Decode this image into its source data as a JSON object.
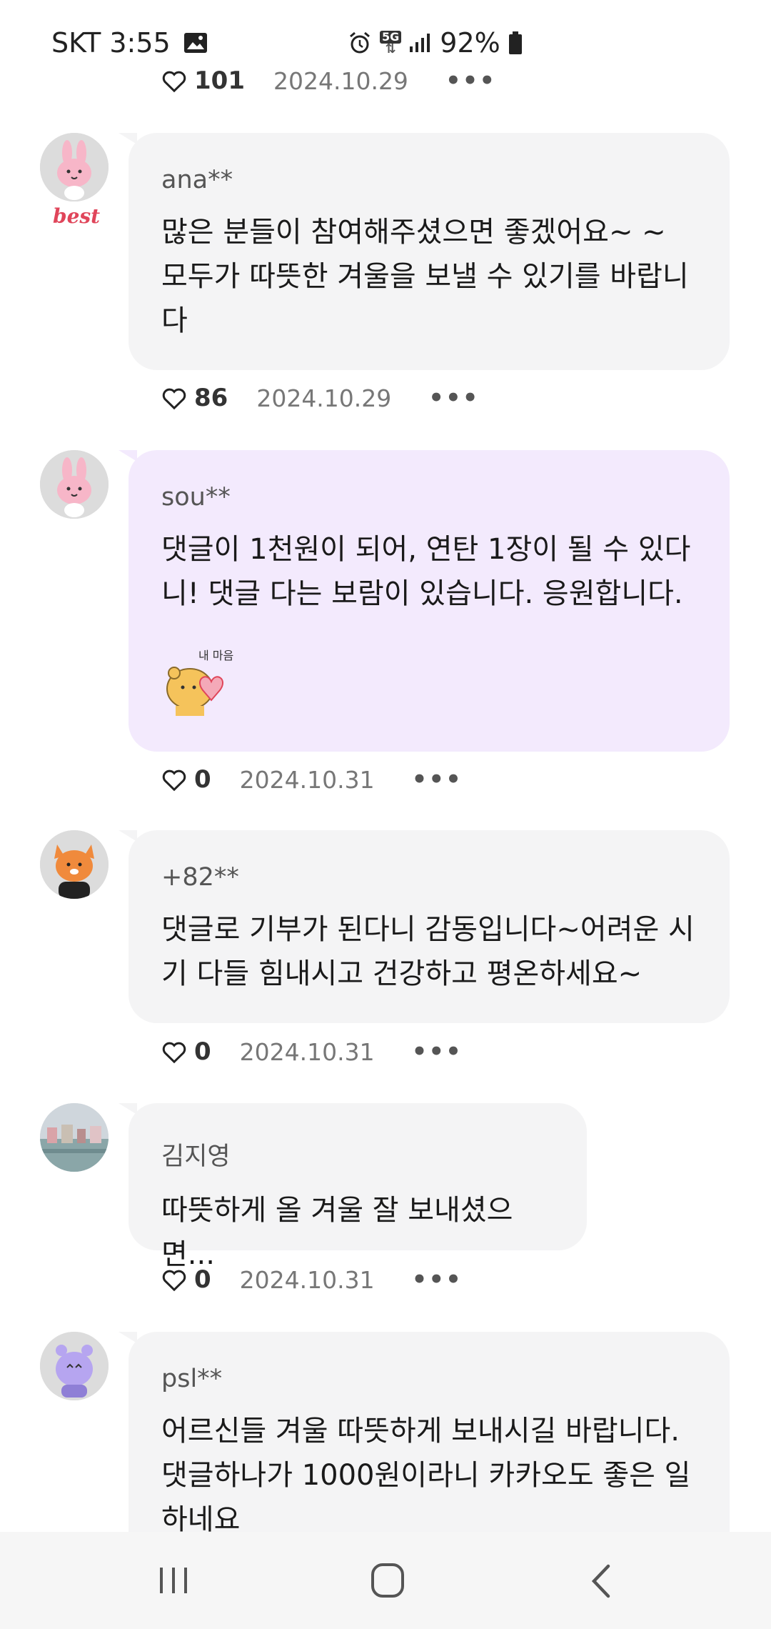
{
  "status_bar": {
    "carrier_time": "SKT 3:55",
    "network": "5G",
    "battery": "92%",
    "icons": [
      "gallery-icon",
      "alarm-icon",
      "5g-icon",
      "signal-icon",
      "battery-icon"
    ]
  },
  "top_partial": {
    "likes": "101",
    "date": "2024.10.29",
    "more": "•••"
  },
  "comments": [
    {
      "author": "ana**",
      "badge": "best",
      "text": "많은 분들이 참여해주셨으면 좋겠어요~ ~ 모두가 따뜻한 겨울을 보낼 수 있기를 바랍니다",
      "likes": "86",
      "date": "2024.10.29",
      "more": "•••",
      "avatar": "pink-rabbit-avatar"
    },
    {
      "author": "sou**",
      "text": "댓글이 1천원이 되어, 연탄 1장이 될 수 있다니! 댓글 다는 보람이 있습니다. 응원합니다.",
      "sticker_text": "내 마음",
      "likes": "0",
      "date": "2024.10.31",
      "more": "•••",
      "avatar": "pink-rabbit-avatar"
    },
    {
      "author": "+82**",
      "text": "댓글로 기부가 된다니  감동입니다~어려운 시기  다들 힘내시고  건강하고 평온하세요~",
      "likes": "0",
      "date": "2024.10.31",
      "more": "•••",
      "avatar": "raccoon-avatar"
    },
    {
      "author": "김지영",
      "text": "따뜻하게 올 겨울 잘 보내셨으면...",
      "likes": "0",
      "date": "2024.10.31",
      "more": "•••",
      "avatar": "photo-avatar"
    },
    {
      "author": "psl**",
      "text": "어르신들 겨울 따뜻하게 보내시길 바랍니다. 댓글하나가 1000원이라니 카카오도 좋은 일 하네요",
      "avatar": "purple-character-avatar"
    }
  ],
  "colors": {
    "bubble": "#f4f4f5",
    "bubble_highlight": "#f3eafd",
    "best_badge": "#e0455a",
    "nav_bar": "#f6f6f6"
  },
  "nav": [
    "recents-icon",
    "home-icon",
    "back-icon"
  ]
}
